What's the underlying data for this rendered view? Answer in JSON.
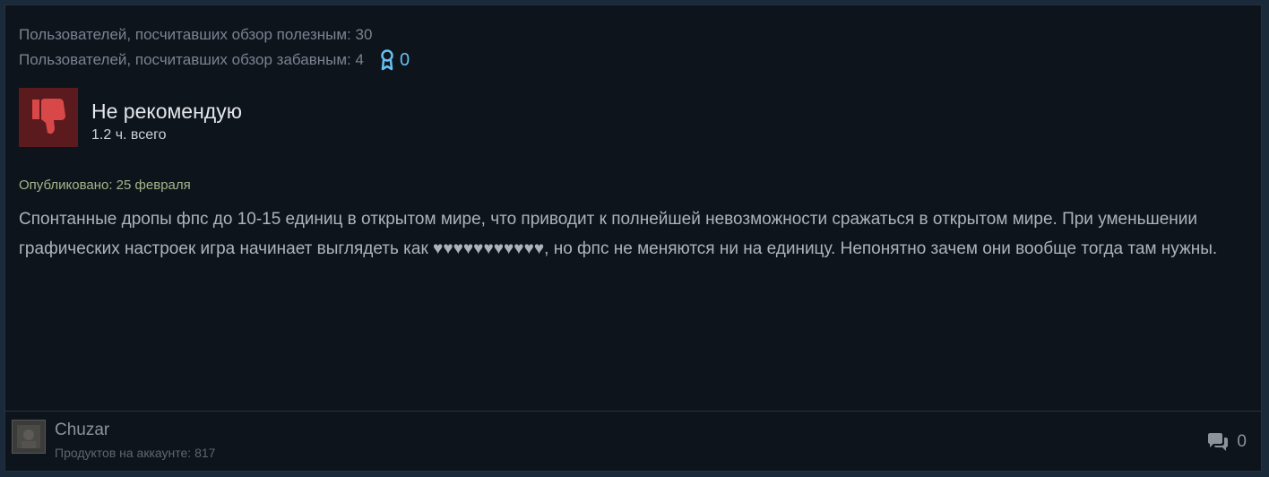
{
  "helpful": {
    "useful_line": "Пользователей, посчитавших обзор полезным: 30",
    "funny_line": "Пользователей, посчитавших обзор забавным: 4",
    "award_count": "0"
  },
  "verdict": {
    "title": "Не рекомендую",
    "hours": "1.2 ч. всего"
  },
  "posted": "Опубликовано: 25 февраля",
  "review_text": "Спонтанные дропы фпс до 10-15 единиц в открытом мире, что приводит к полнейшей невозможности сражаться в открытом мире. При уменьшении графических настроек игра начинает выглядеть как ♥♥♥♥♥♥♥♥♥♥♥, но фпс не меняются ни на единицу. Непонятно зачем они вообще тогда там нужны.",
  "author": {
    "name": "Chuzar",
    "products": "Продуктов на аккаунте: 817"
  },
  "comments": {
    "count": "0"
  },
  "colors": {
    "background": "#0e141c",
    "award_blue": "#66c0f4",
    "thumb_red": "#d94848"
  }
}
